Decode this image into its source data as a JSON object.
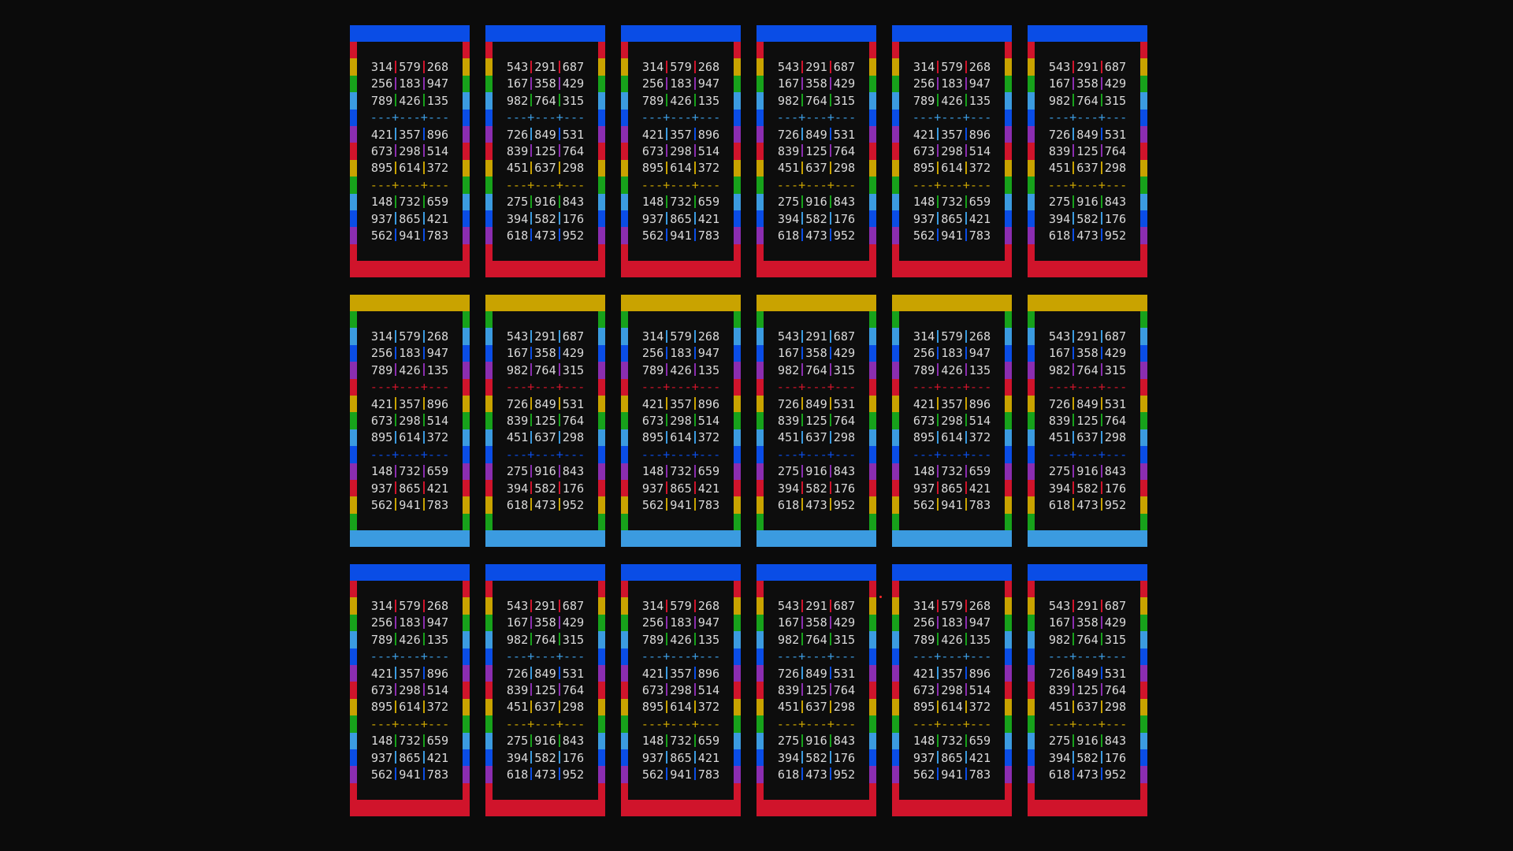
{
  "palette": {
    "blue": "#0a4de6",
    "red": "#d0142b",
    "yellow": "#c9a300",
    "green": "#17a21b",
    "sky": "#3b9be0",
    "purple": "#8b2db0",
    "dot": "#ff2a2a"
  },
  "boards": {
    "A": {
      "rows": [
        [
          "314",
          "579",
          "268"
        ],
        [
          "256",
          "183",
          "947"
        ],
        [
          "789",
          "426",
          "135"
        ],
        [
          "421",
          "357",
          "896"
        ],
        [
          "673",
          "298",
          "514"
        ],
        [
          "895",
          "614",
          "372"
        ],
        [
          "148",
          "732",
          "659"
        ],
        [
          "937",
          "865",
          "421"
        ],
        [
          "562",
          "941",
          "783"
        ]
      ],
      "separator": "---+---+---"
    },
    "B": {
      "rows": [
        [
          "543",
          "291",
          "687"
        ],
        [
          "167",
          "358",
          "429"
        ],
        [
          "982",
          "764",
          "315"
        ],
        [
          "726",
          "849",
          "531"
        ],
        [
          "839",
          "125",
          "764"
        ],
        [
          "451",
          "637",
          "298"
        ],
        [
          "275",
          "916",
          "843"
        ],
        [
          "394",
          "582",
          "176"
        ],
        [
          "618",
          "473",
          "952"
        ]
      ],
      "separator": "---+---+---"
    }
  },
  "tile_rows": [
    {
      "style": "blue-red",
      "boards": [
        "A",
        "B",
        "A",
        "B",
        "A",
        "B"
      ]
    },
    {
      "style": "yellow-sky",
      "boards": [
        "A",
        "B",
        "A",
        "B",
        "A",
        "B"
      ]
    },
    {
      "style": "blue-red",
      "boards": [
        "A",
        "B",
        "A",
        "B",
        "A",
        "B"
      ]
    }
  ]
}
